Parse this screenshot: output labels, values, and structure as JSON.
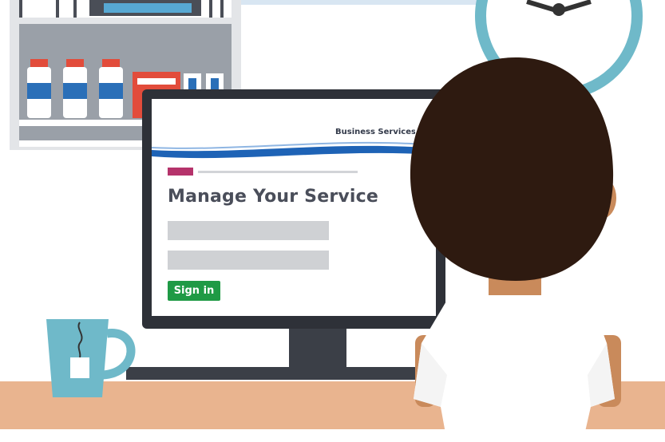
{
  "screen": {
    "brand_text": "Business Services",
    "page_title": "Manage Your Service",
    "sign_in_label": "Sign in"
  },
  "colors": {
    "accent_magenta": "#b5336b",
    "brand_blue": "#1e63b6",
    "sign_in_green": "#1f9a45",
    "mug_teal": "#6fb9c9",
    "desk_tan": "#e9b48f",
    "hair_brown": "#2e1a10",
    "skin": "#c98a5b"
  },
  "icons": [
    "clock-icon",
    "mug-icon",
    "tea-bag-icon",
    "medicine-bottle-icon",
    "medicine-box-icon"
  ]
}
